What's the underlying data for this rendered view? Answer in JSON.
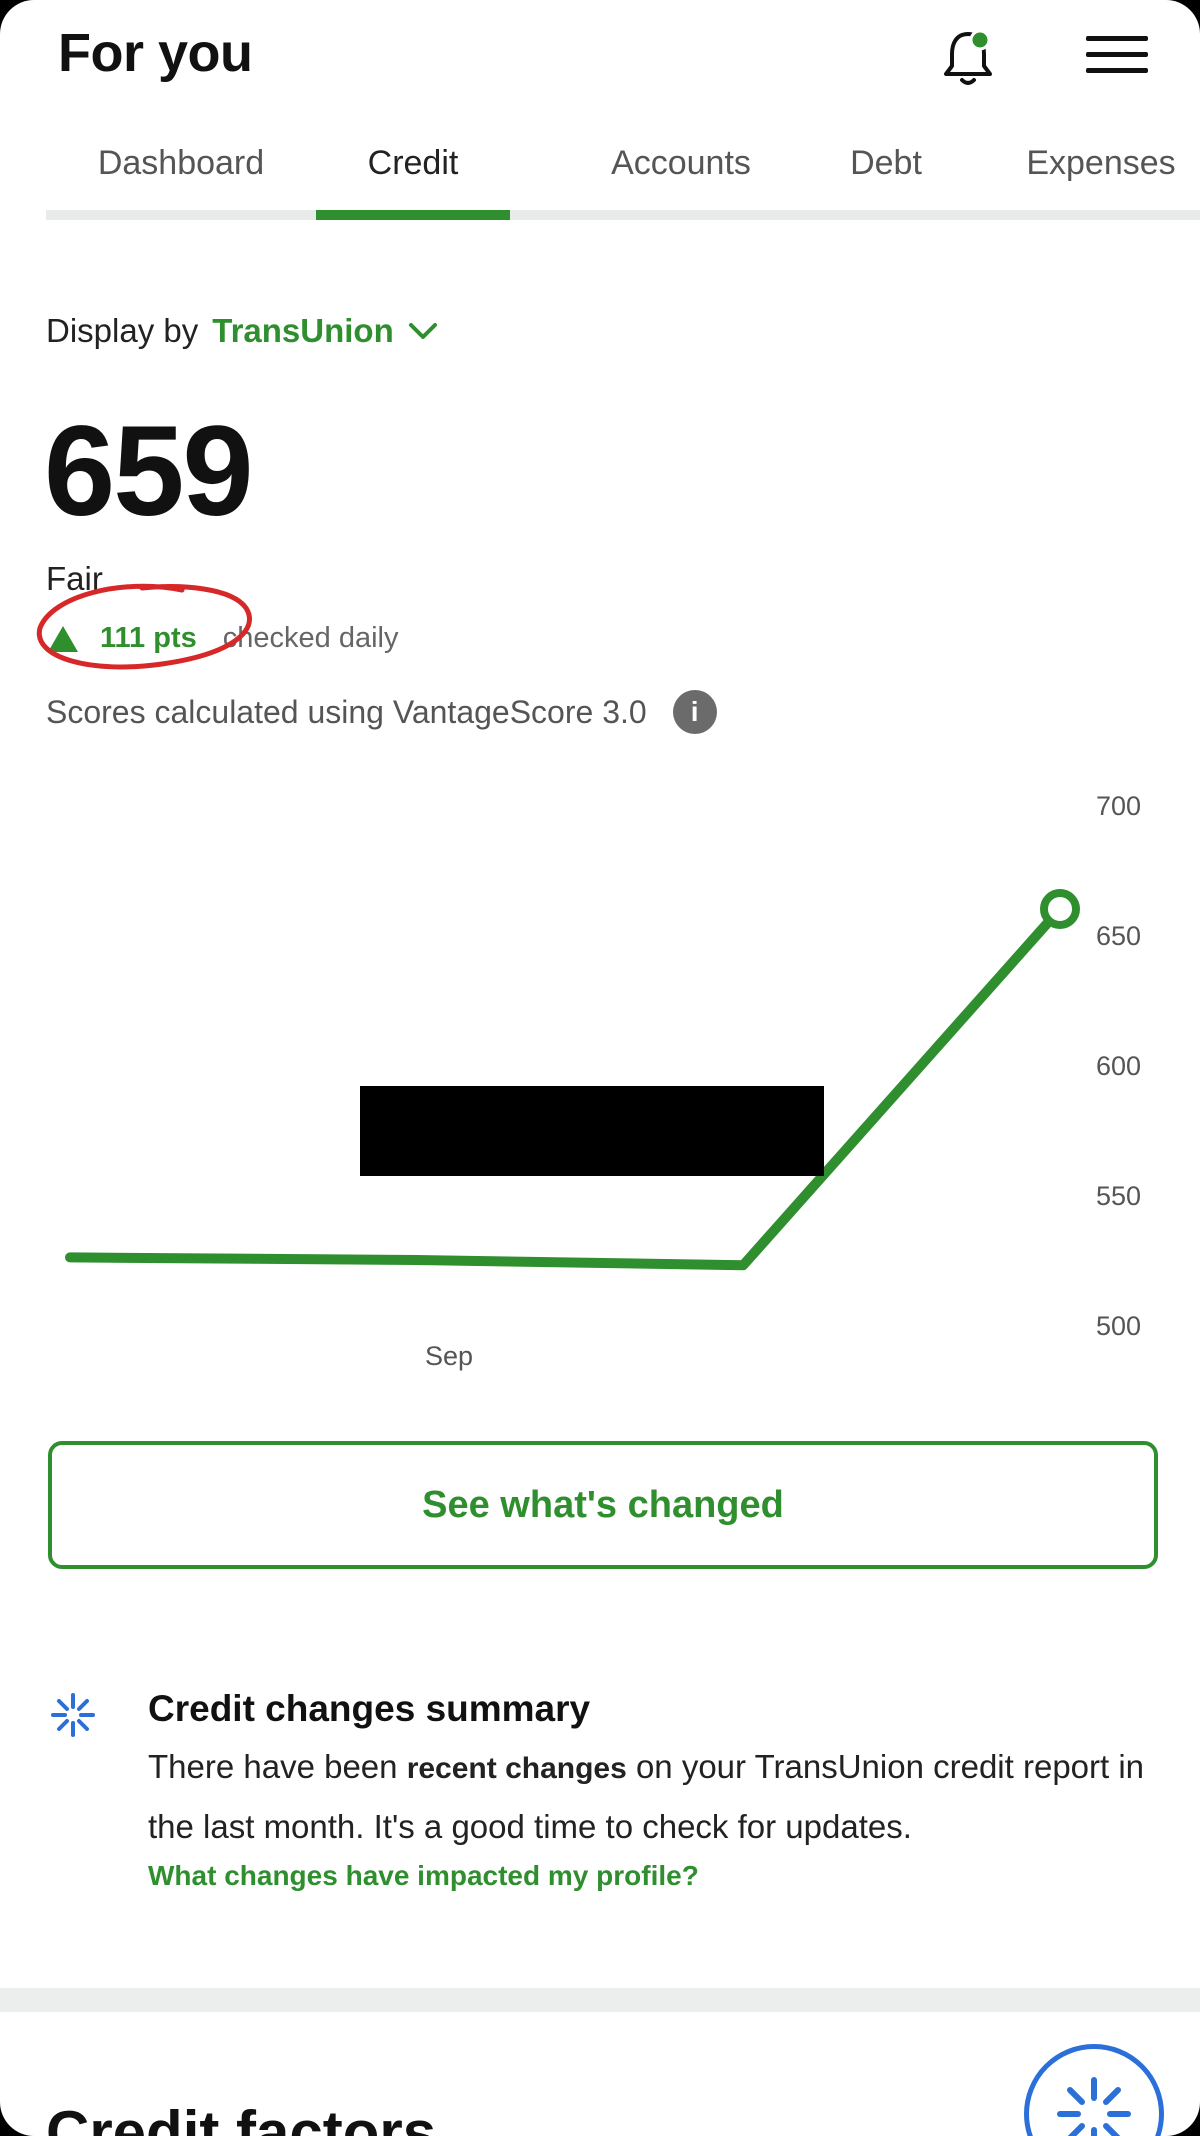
{
  "header": {
    "title": "For you",
    "bell_icon": "bell-with-dot-icon",
    "menu_icon": "hamburger-menu-icon"
  },
  "tabs": [
    {
      "label": "Dashboard",
      "active": false
    },
    {
      "label": "Credit",
      "active": true
    },
    {
      "label": "Accounts",
      "active": false
    },
    {
      "label": "Debt",
      "active": false
    },
    {
      "label": "Expenses",
      "active": false
    }
  ],
  "display_by": {
    "label": "Display by",
    "selected": "TransUnion"
  },
  "score": {
    "value": "659",
    "rating": "Fair",
    "change": "111 pts",
    "change_note": "checked daily",
    "model_line": "Scores calculated using VantageScore 3.0",
    "info_icon_glyph": "i"
  },
  "chart_data": {
    "type": "line",
    "x_tick_labels": [
      "Sep"
    ],
    "y_ticks": [
      700,
      650,
      600,
      550,
      500
    ],
    "ylim": [
      500,
      700
    ],
    "series": [
      {
        "color": "#2f8f2f",
        "points": [
          {
            "t": 0.0,
            "y": 526
          },
          {
            "t": 0.35,
            "y": 525
          },
          {
            "t": 0.68,
            "y": 523
          },
          {
            "t": 1.0,
            "y": 660
          }
        ]
      }
    ],
    "grid": false
  },
  "cta": {
    "label": "See what's changed"
  },
  "summary": {
    "title": "Credit changes summary",
    "body_prefix": "There have been ",
    "body_bold": "recent changes",
    "body_suffix": " on your TransUnion credit report in the last month. It's a good time to check for updates.",
    "link": "What changes have impacted my profile?"
  },
  "next_section": {
    "title": "Credit factors"
  },
  "colors": {
    "brand_green": "#2f8f2f",
    "blue": "#2b6fd9",
    "annotation_red": "#d62828"
  }
}
